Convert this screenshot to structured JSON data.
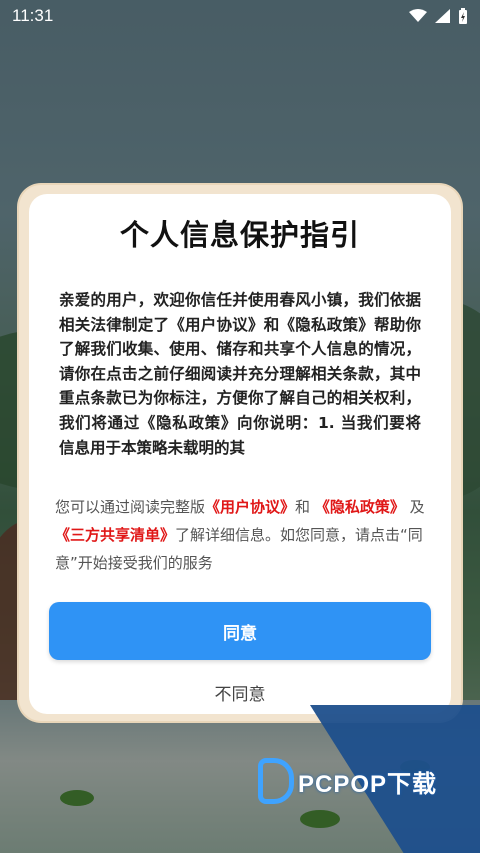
{
  "status_bar": {
    "time": "11:31"
  },
  "dialog": {
    "title": "个人信息保护指引",
    "body": "亲爱的用户，欢迎你信任并使用春风小镇，我们依据相关法律制定了《用户协议》和《隐私政策》帮助你了解我们收集、使用、储存和共享个人信息的情况，请你在点击之前仔细阅读并充分理解相关条款，其中重点条款已为你标注，方便你了解自己的相关权利，我们将通过《隐私政策》向你说明：1. 当我们要将信息用于本策略未载明的其",
    "note": {
      "prefix": "您可以通过阅读完整版",
      "user_agreement": "《用户协议》",
      "and": "和",
      "privacy_policy": "《隐私政策》",
      "and2": "及",
      "third_party": "《三方共享清单》",
      "suffix": "了解详细信息。如您同意，请点击“同意”开始接受我们的服务"
    },
    "agree_label": "同意",
    "disagree_label": "不同意"
  },
  "watermark": {
    "text": "PCPOP下载"
  },
  "colors": {
    "accent": "#2f93f5",
    "link": "#e01717",
    "frame": "#f2e4cf"
  }
}
